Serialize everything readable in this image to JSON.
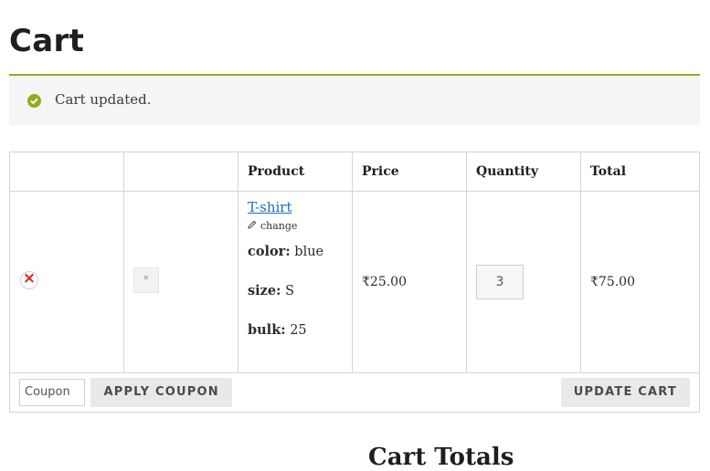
{
  "page": {
    "title": "Cart"
  },
  "notice": {
    "message": "Cart updated."
  },
  "table": {
    "headers": {
      "remove": "",
      "thumbnail": "",
      "product": "Product",
      "price": "Price",
      "quantity": "Quantity",
      "total": "Total"
    }
  },
  "item": {
    "remove_symbol": "×",
    "product_name": "T-shirt",
    "change_label": "change",
    "attributes": [
      {
        "label": "color:",
        "value": "blue"
      },
      {
        "label": "size:",
        "value": "S"
      },
      {
        "label": "bulk:",
        "value": "25"
      }
    ],
    "price": "₹25.00",
    "quantity": "3",
    "total": "₹75.00"
  },
  "actions": {
    "coupon_placeholder": "Coupon",
    "apply_coupon_label": "APPLY COUPON",
    "update_cart_label": "UPDATE CART"
  },
  "totals": {
    "heading": "Cart Totals"
  },
  "colors": {
    "accent": "#8fae1b",
    "link": "#1e6dba",
    "remove": "#e2231a"
  }
}
